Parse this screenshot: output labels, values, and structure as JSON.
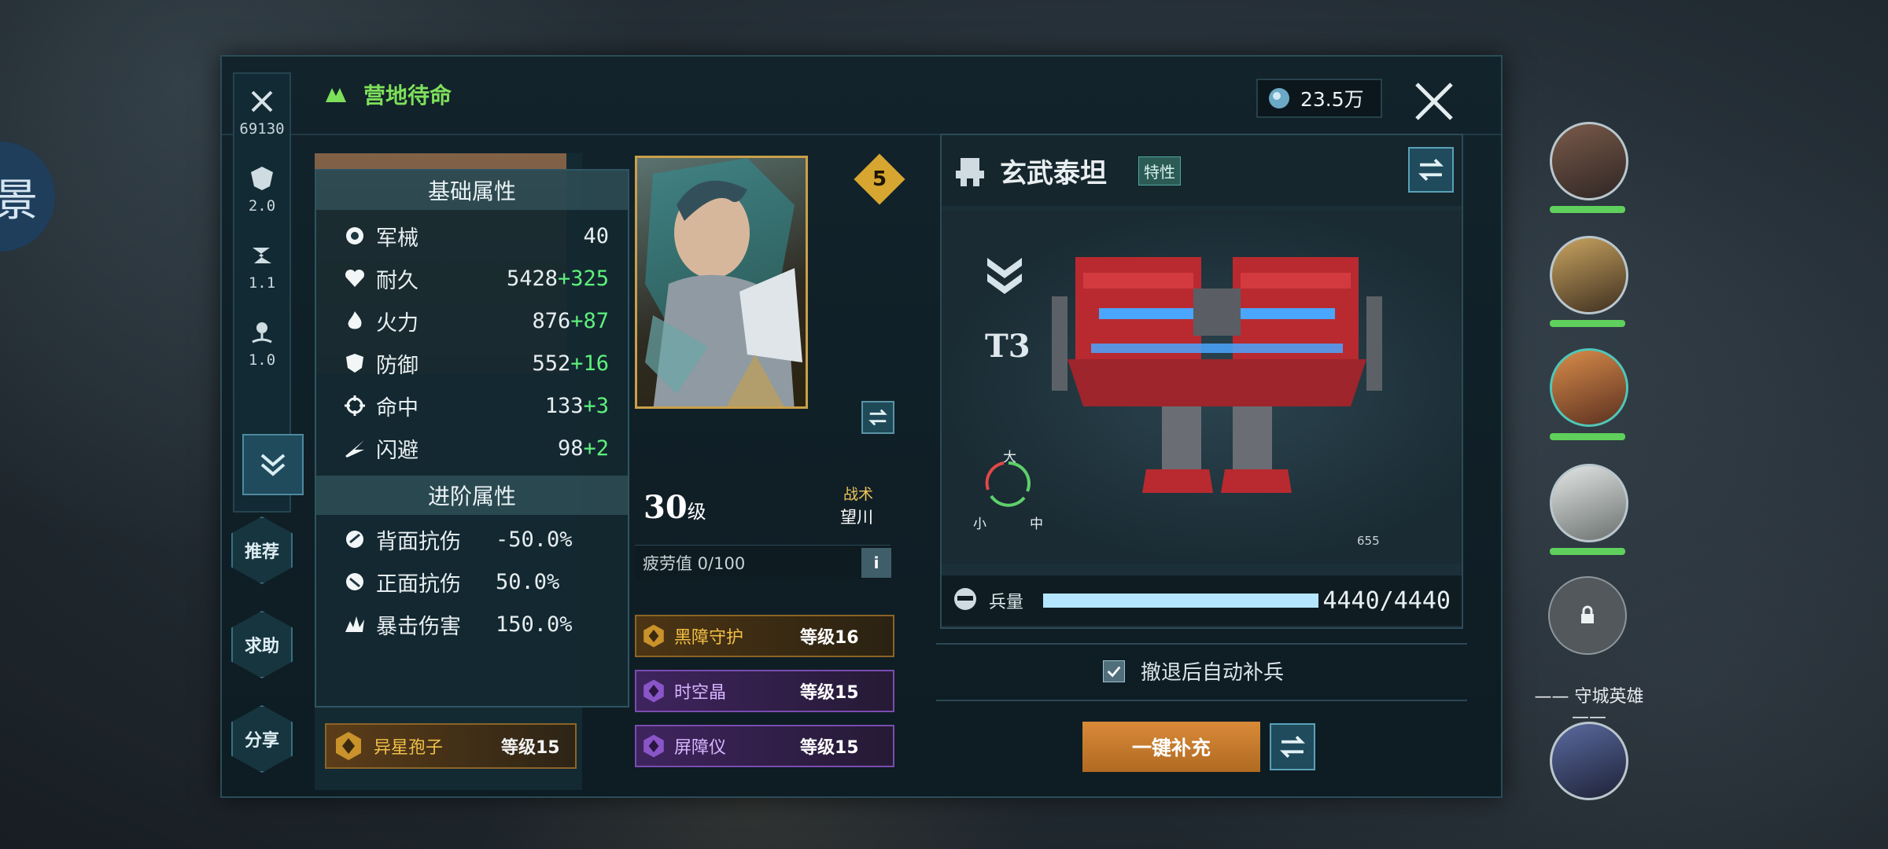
{
  "header": {
    "title": "营地待命",
    "currency": "23.5万"
  },
  "rail": {
    "stats": [
      {
        "icon": "crossed-swords-icon",
        "value": "69130"
      },
      {
        "icon": "armor-icon",
        "value": "2.0"
      },
      {
        "icon": "speed-icon",
        "value": "1.1"
      },
      {
        "icon": "location-icon",
        "value": "1.0"
      }
    ]
  },
  "side_buttons": {
    "recommend": "推荐",
    "help": "求助",
    "share": "分享"
  },
  "base_stats": {
    "heading": "基础属性",
    "rows": [
      {
        "icon": "mechanics-icon",
        "label": "军械",
        "value": "40",
        "bonus": ""
      },
      {
        "icon": "heart-icon",
        "label": "耐久",
        "value": "5428",
        "bonus": "+325"
      },
      {
        "icon": "fire-icon",
        "label": "火力",
        "value": "876",
        "bonus": "+87"
      },
      {
        "icon": "shield-icon",
        "label": "防御",
        "value": "552",
        "bonus": "+16"
      },
      {
        "icon": "crosshair-icon",
        "label": "命中",
        "value": "133",
        "bonus": "+3"
      },
      {
        "icon": "dodge-icon",
        "label": "闪避",
        "value": "98",
        "bonus": "+2"
      }
    ]
  },
  "adv_stats": {
    "heading": "进阶属性",
    "rows": [
      {
        "icon": "back-resist-icon",
        "label": "背面抗伤",
        "value": "-50.0%"
      },
      {
        "icon": "front-resist-icon",
        "label": "正面抗伤",
        "value": "50.0%"
      },
      {
        "icon": "crit-icon",
        "label": "暴击伤害",
        "value": "150.0%"
      }
    ]
  },
  "left_items": [
    {
      "name": "异星孢子",
      "level": "等级15"
    }
  ],
  "hero": {
    "stars": "5",
    "level": "30",
    "level_unit": "级",
    "role": "战术",
    "name": "望川",
    "fatigue": "疲劳值 0/100"
  },
  "gear": [
    {
      "name": "黑障守护",
      "level": "等级16",
      "tier": "gold"
    },
    {
      "name": "时空晶",
      "level": "等级15",
      "tier": "purple"
    },
    {
      "name": "屏障仪",
      "level": "等级15",
      "tier": "purple"
    }
  ],
  "mech": {
    "name": "玄武泰坦",
    "trait": "特性",
    "tier": "T3",
    "size_labels": {
      "big": "大",
      "small": "小",
      "mid": "中"
    },
    "marker": "655",
    "troop_label": "兵量",
    "troop_value": "4440/4440",
    "troop_fill": 1.0
  },
  "autofill_label": "撤退后自动补兵",
  "fill_button": "一键补充",
  "guard_label": "守城英雄",
  "colors": {
    "accent_green": "#7ee05a",
    "gold": "#d7a630",
    "orange_btn": "#d98a38"
  }
}
